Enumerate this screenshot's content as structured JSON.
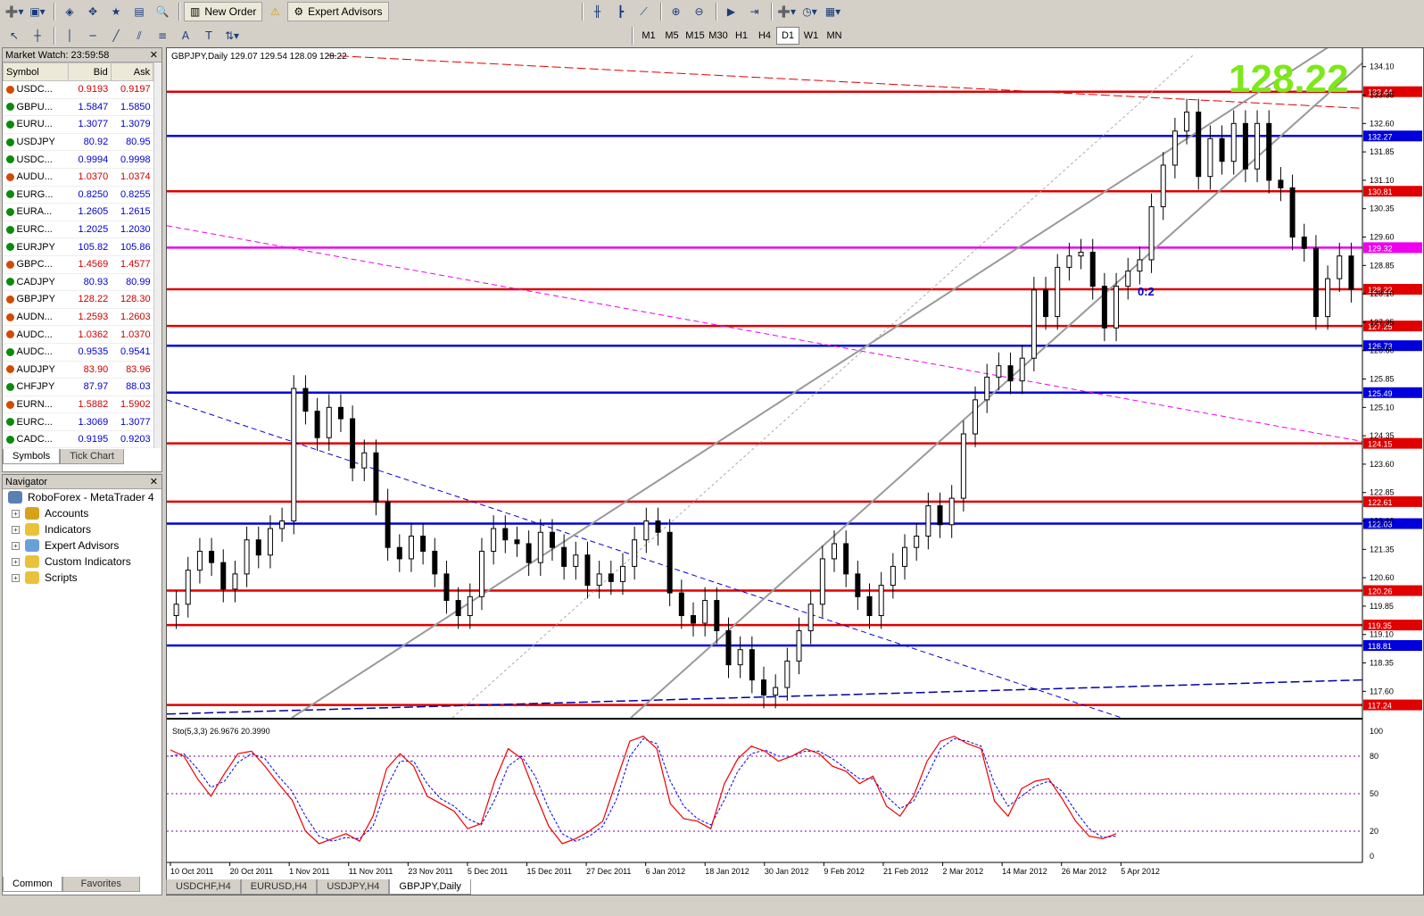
{
  "toolbar": {
    "new_order": "New Order",
    "expert_advisors": "Expert Advisors",
    "timeframes": [
      "M1",
      "M5",
      "M15",
      "M30",
      "H1",
      "H4",
      "D1",
      "W1",
      "MN"
    ],
    "active_tf": "D1"
  },
  "market_watch": {
    "title": "Market Watch: 23:59:58",
    "headers": [
      "Symbol",
      "Bid",
      "Ask"
    ],
    "rows": [
      {
        "s": "USDC...",
        "bid": "0.9193",
        "ask": "0.9197",
        "dir": "dn"
      },
      {
        "s": "GBPU...",
        "bid": "1.5847",
        "ask": "1.5850",
        "dir": "up"
      },
      {
        "s": "EURU...",
        "bid": "1.3077",
        "ask": "1.3079",
        "dir": "up"
      },
      {
        "s": "USDJPY",
        "bid": "80.92",
        "ask": "80.95",
        "dir": "up"
      },
      {
        "s": "USDC...",
        "bid": "0.9994",
        "ask": "0.9998",
        "dir": "up"
      },
      {
        "s": "AUDU...",
        "bid": "1.0370",
        "ask": "1.0374",
        "dir": "dn"
      },
      {
        "s": "EURG...",
        "bid": "0.8250",
        "ask": "0.8255",
        "dir": "up"
      },
      {
        "s": "EURA...",
        "bid": "1.2605",
        "ask": "1.2615",
        "dir": "up"
      },
      {
        "s": "EURC...",
        "bid": "1.2025",
        "ask": "1.2030",
        "dir": "up"
      },
      {
        "s": "EURJPY",
        "bid": "105.82",
        "ask": "105.86",
        "dir": "up"
      },
      {
        "s": "GBPC...",
        "bid": "1.4569",
        "ask": "1.4577",
        "dir": "dn"
      },
      {
        "s": "CADJPY",
        "bid": "80.93",
        "ask": "80.99",
        "dir": "up"
      },
      {
        "s": "GBPJPY",
        "bid": "128.22",
        "ask": "128.30",
        "dir": "dn"
      },
      {
        "s": "AUDN...",
        "bid": "1.2593",
        "ask": "1.2603",
        "dir": "dn"
      },
      {
        "s": "AUDC...",
        "bid": "1.0362",
        "ask": "1.0370",
        "dir": "dn"
      },
      {
        "s": "AUDC...",
        "bid": "0.9535",
        "ask": "0.9541",
        "dir": "up"
      },
      {
        "s": "AUDJPY",
        "bid": "83.90",
        "ask": "83.96",
        "dir": "dn"
      },
      {
        "s": "CHFJPY",
        "bid": "87.97",
        "ask": "88.03",
        "dir": "up"
      },
      {
        "s": "EURN...",
        "bid": "1.5882",
        "ask": "1.5902",
        "dir": "dn"
      },
      {
        "s": "EURC...",
        "bid": "1.3069",
        "ask": "1.3077",
        "dir": "up"
      },
      {
        "s": "CADC...",
        "bid": "0.9195",
        "ask": "0.9203",
        "dir": "up"
      }
    ],
    "tabs": [
      "Symbols",
      "Tick Chart"
    ]
  },
  "navigator": {
    "title": "Navigator",
    "root": "RoboForex - MetaTrader 4",
    "items": [
      "Accounts",
      "Indicators",
      "Expert Advisors",
      "Custom Indicators",
      "Scripts"
    ],
    "tabs": [
      "Common",
      "Favorites"
    ]
  },
  "chart": {
    "header": "GBPJPY,Daily  129.07 129.54 128.09 128.22",
    "big_price": "128.22",
    "label_02": "0:2",
    "osc_header": "Sto(5,3,3) 26.9676 20.3990",
    "tabs": [
      "USDCHF,H4",
      "EURUSD,H4",
      "USDJPY,H4",
      "GBPJPY,Daily"
    ],
    "active_tab": "GBPJPY,Daily"
  },
  "chart_data": {
    "type": "line",
    "price_range": [
      116.9,
      134.4
    ],
    "y_ticks": [
      "134.10",
      "133.35",
      "132.60",
      "131.85",
      "131.10",
      "130.35",
      "129.60",
      "128.85",
      "128.10",
      "127.35",
      "126.60",
      "125.85",
      "125.10",
      "124.35",
      "123.60",
      "122.85",
      "122.10",
      "121.35",
      "120.60",
      "119.85",
      "119.10",
      "118.35",
      "117.60"
    ],
    "x_labels": [
      "10 Oct 2011",
      "20 Oct 2011",
      "1 Nov 2011",
      "11 Nov 2011",
      "23 Nov 2011",
      "5 Dec 2011",
      "15 Dec 2011",
      "27 Dec 2011",
      "6 Jan 2012",
      "18 Jan 2012",
      "30 Jan 2012",
      "9 Feb 2012",
      "21 Feb 2012",
      "2 Mar 2012",
      "14 Mar 2012",
      "26 Mar 2012",
      "5 Apr 2012"
    ],
    "levels": [
      {
        "v": 133.44,
        "label": "133.44",
        "color": "#e00000"
      },
      {
        "v": 132.27,
        "label": "132.27",
        "color": "#0000dd"
      },
      {
        "v": 130.81,
        "label": "130.81",
        "color": "#e00000"
      },
      {
        "v": 129.32,
        "label": "129.32",
        "color": "#ee00ee"
      },
      {
        "v": 128.22,
        "label": "128.22",
        "color": "#e00000"
      },
      {
        "v": 127.25,
        "label": "127.25",
        "color": "#e00000"
      },
      {
        "v": 126.73,
        "label": "126.73",
        "color": "#0000dd"
      },
      {
        "v": 125.49,
        "label": "125.49",
        "color": "#0000dd"
      },
      {
        "v": 124.15,
        "label": "124.15",
        "color": "#e00000"
      },
      {
        "v": 122.61,
        "label": "122.61",
        "color": "#e00000"
      },
      {
        "v": 122.03,
        "label": "122.03",
        "color": "#0000dd"
      },
      {
        "v": 120.26,
        "label": "120.26",
        "color": "#e00000"
      },
      {
        "v": 119.35,
        "label": "119.35",
        "color": "#e00000"
      },
      {
        "v": 118.81,
        "label": "118.81",
        "color": "#0000dd"
      },
      {
        "v": 117.24,
        "label": "117.24",
        "color": "#e00000"
      }
    ],
    "closes": [
      119.9,
      120.8,
      121.3,
      121.0,
      120.3,
      120.7,
      121.6,
      121.2,
      121.9,
      122.1,
      125.6,
      125.0,
      124.3,
      125.1,
      124.8,
      123.5,
      123.9,
      122.6,
      121.4,
      121.1,
      121.7,
      121.3,
      120.7,
      120.0,
      119.6,
      120.1,
      121.3,
      121.9,
      121.6,
      121.5,
      121.0,
      121.8,
      121.4,
      120.9,
      121.2,
      120.4,
      120.7,
      120.5,
      120.9,
      121.6,
      122.1,
      121.8,
      120.2,
      119.6,
      119.4,
      120.0,
      119.2,
      118.3,
      118.7,
      117.9,
      117.5,
      117.7,
      118.4,
      119.2,
      119.9,
      121.1,
      121.5,
      120.7,
      120.1,
      119.6,
      120.4,
      120.9,
      121.4,
      121.7,
      122.5,
      122.0,
      122.7,
      124.4,
      125.3,
      125.9,
      126.2,
      125.8,
      126.4,
      128.2,
      127.5,
      128.8,
      129.1,
      129.2,
      128.3,
      127.2,
      128.3,
      128.7,
      129.0,
      130.4,
      131.5,
      132.4,
      132.9,
      131.2,
      132.2,
      131.6,
      132.6,
      131.4,
      132.6,
      131.1,
      130.9,
      129.6,
      129.3,
      127.5,
      128.5,
      129.1,
      128.22
    ],
    "stoch_main": [
      85,
      80,
      62,
      48,
      66,
      82,
      84,
      72,
      58,
      45,
      20,
      10,
      14,
      18,
      12,
      32,
      70,
      82,
      72,
      48,
      42,
      36,
      22,
      26,
      60,
      86,
      78,
      50,
      24,
      10,
      14,
      20,
      28,
      60,
      92,
      96,
      86,
      42,
      30,
      28,
      22,
      58,
      78,
      88,
      84,
      76,
      80,
      86,
      82,
      72,
      68,
      58,
      64,
      40,
      32,
      48,
      76,
      92,
      96,
      90,
      86,
      44,
      32,
      54,
      60,
      62,
      46,
      28,
      16,
      14,
      18
    ],
    "stoch_signal": [
      80,
      82,
      70,
      55,
      60,
      75,
      82,
      78,
      64,
      52,
      32,
      16,
      12,
      15,
      14,
      24,
      55,
      76,
      76,
      58,
      46,
      40,
      30,
      25,
      45,
      72,
      80,
      64,
      38,
      18,
      12,
      16,
      24,
      45,
      80,
      94,
      90,
      60,
      40,
      30,
      25,
      45,
      68,
      82,
      85,
      80,
      80,
      84,
      84,
      78,
      70,
      62,
      62,
      48,
      38,
      44,
      64,
      86,
      94,
      92,
      88,
      58,
      40,
      48,
      56,
      60,
      52,
      36,
      22,
      15,
      16
    ]
  }
}
